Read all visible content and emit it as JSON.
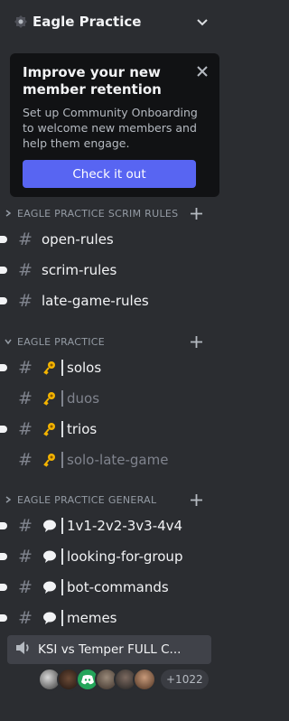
{
  "server": {
    "name": "Eagle Practice"
  },
  "onboarding": {
    "title": "Improve your new member retention",
    "body": "Set up Community Onboarding to welcome new members and help them engage.",
    "button": "Check it out"
  },
  "categories": [
    {
      "name": "EAGLE PRACTICE SCRIM RULES",
      "channels": [
        {
          "name": "open-rules",
          "unread": true,
          "muted": false
        },
        {
          "name": "scrim-rules",
          "unread": true,
          "muted": false
        },
        {
          "name": "late-game-rules",
          "unread": true,
          "muted": false
        }
      ]
    },
    {
      "name": "EAGLE PRACTICE",
      "channels": [
        {
          "name": "solos",
          "emoji": "key-icon",
          "unread": true,
          "muted": false
        },
        {
          "name": "duos",
          "emoji": "key-icon",
          "unread": false,
          "muted": true
        },
        {
          "name": "trios",
          "emoji": "key-icon",
          "unread": true,
          "muted": false
        },
        {
          "name": "solo-late-game",
          "emoji": "key-icon",
          "unread": false,
          "muted": true
        }
      ]
    },
    {
      "name": "EAGLE PRACTICE GENERAL",
      "channels": [
        {
          "name": "1v1-2v2-3v3-4v4",
          "emoji": "speech-bubble-icon",
          "unread": true,
          "muted": false
        },
        {
          "name": "looking-for-group",
          "emoji": "speech-bubble-icon",
          "unread": true,
          "muted": false
        },
        {
          "name": "bot-commands",
          "emoji": "speech-bubble-icon",
          "unread": true,
          "muted": false
        },
        {
          "name": "memes",
          "emoji": "speech-bubble-icon",
          "unread": true,
          "muted": false
        }
      ]
    }
  ],
  "voice": {
    "name": "KSI vs Temper FULL C...",
    "member_count": "+1022"
  },
  "colors": {
    "background": "#2b2d31",
    "accent": "#5865f2",
    "card": "#111214",
    "voice_active": "#404249"
  }
}
